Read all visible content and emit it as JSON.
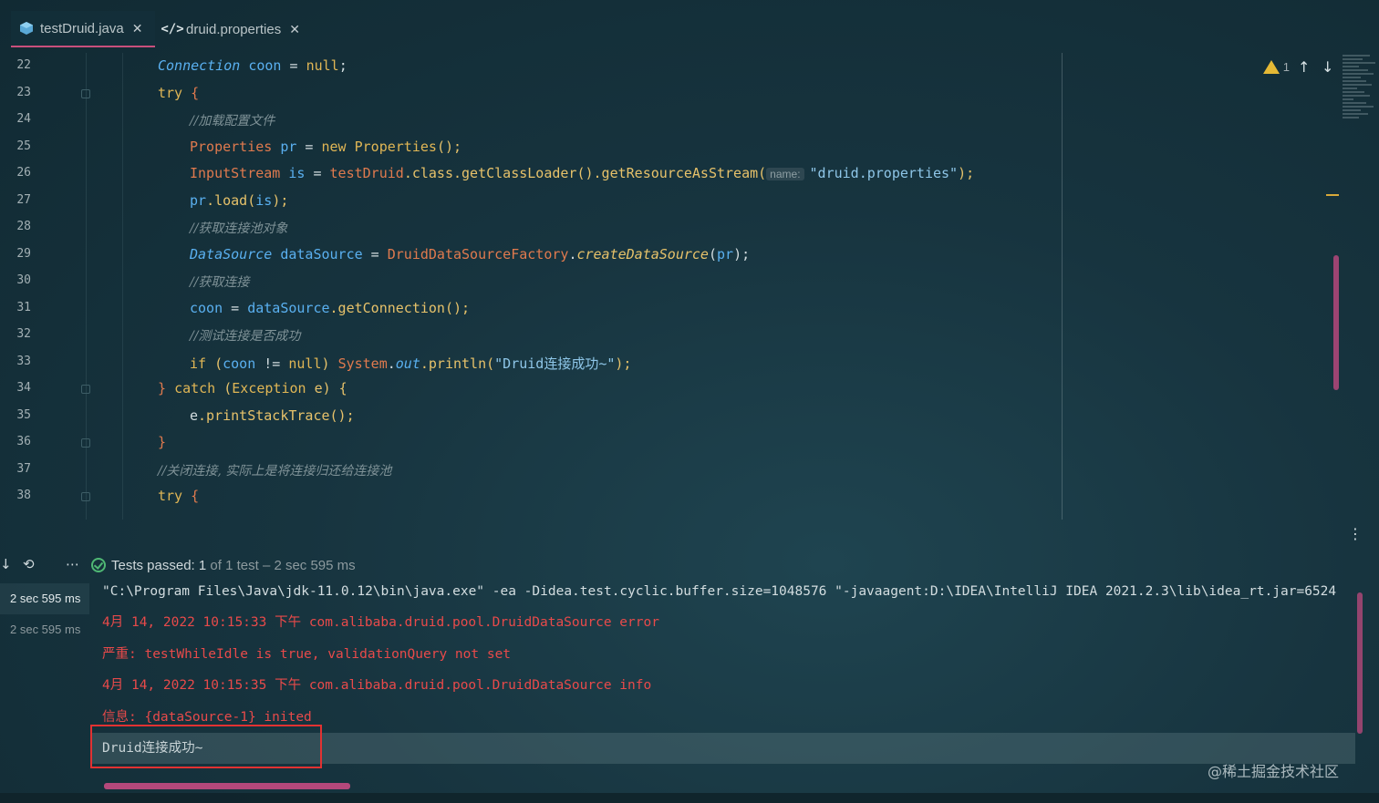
{
  "tabs": [
    {
      "label": "testDruid.java",
      "icon": "java-class-icon"
    },
    {
      "label": "druid.properties",
      "icon": "code-tag-icon"
    }
  ],
  "editor": {
    "line_numbers": [
      "22",
      "23",
      "24",
      "25",
      "26",
      "27",
      "28",
      "29",
      "30",
      "31",
      "32",
      "33",
      "34",
      "35",
      "36",
      "37",
      "38"
    ],
    "warning_count": "1",
    "lines": {
      "l22": {
        "a": "Connection",
        "b": " coon",
        "c": " = ",
        "d": "null",
        "e": ";"
      },
      "l23": {
        "a": "try",
        "b": " {"
      },
      "l24": {
        "a": "//加载配置文件"
      },
      "l25": {
        "a": "Properties",
        "b": " pr",
        "c": " = ",
        "d": "new ",
        "e": "Properties",
        "f": "();"
      },
      "l26": {
        "a": "InputStream",
        "b": " is",
        "c": " = ",
        "d": "testDruid",
        "e": ".class.getClassLoader().getResourceAsStream(",
        "hint": "name:",
        "f": "\"druid.properties\"",
        "g": ");"
      },
      "l27": {
        "a": "pr",
        "b": ".load(",
        "c": "is",
        "d": ");"
      },
      "l28": {
        "a": "//获取连接池对象"
      },
      "l29": {
        "a": "DataSource",
        "b": " dataSource",
        "c": " = ",
        "d": "DruidDataSourceFactory",
        "e": ".",
        "f": "createDataSource",
        "g": "(",
        "h": "pr",
        "i": ");"
      },
      "l30": {
        "a": "//获取连接"
      },
      "l31": {
        "a": "coon",
        "b": " = ",
        "c": "dataSource",
        "d": ".getConnection();"
      },
      "l32": {
        "a": "//测试连接是否成功"
      },
      "l33": {
        "a": "if",
        "b": " (",
        "c": "coon",
        "d": " != ",
        "e": "null",
        "f": ") ",
        "g": "System",
        "h": ".",
        "i": "out",
        "j": ".println(",
        "k": "\"Druid连接成功~\"",
        "l": ");"
      },
      "l34": {
        "a": "} ",
        "b": "catch",
        "c": " (",
        "d": "Exception",
        "e": " e) {"
      },
      "l35": {
        "a": "e",
        "b": ".printStackTrace();"
      },
      "l36": {
        "a": "}"
      },
      "l37": {
        "a": "//关闭连接, 实际上是将连接归还给连接池"
      },
      "l38": {
        "a": "try",
        "b": " {"
      }
    }
  },
  "run": {
    "tests_passed_label": "Tests passed:",
    "tests_passed_count": "1",
    "tests_of": "of 1 test – 2 sec 595 ms",
    "tree": [
      {
        "label": "2 sec 595 ms"
      },
      {
        "label": "2 sec 595 ms"
      }
    ],
    "console": [
      "\"C:\\Program Files\\Java\\jdk-11.0.12\\bin\\java.exe\" -ea -Didea.test.cyclic.buffer.size=1048576 \"-javaagent:D:\\IDEA\\IntelliJ IDEA 2021.2.3\\lib\\idea_rt.jar=6524",
      "4月 14, 2022 10:15:33 下午 com.alibaba.druid.pool.DruidDataSource error",
      "严重: testWhileIdle is true, validationQuery not set",
      "4月 14, 2022 10:15:35 下午 com.alibaba.druid.pool.DruidDataSource info",
      "信息: {dataSource-1} inited",
      "Druid连接成功~"
    ],
    "watermark": "@稀土掘金技术社区"
  }
}
